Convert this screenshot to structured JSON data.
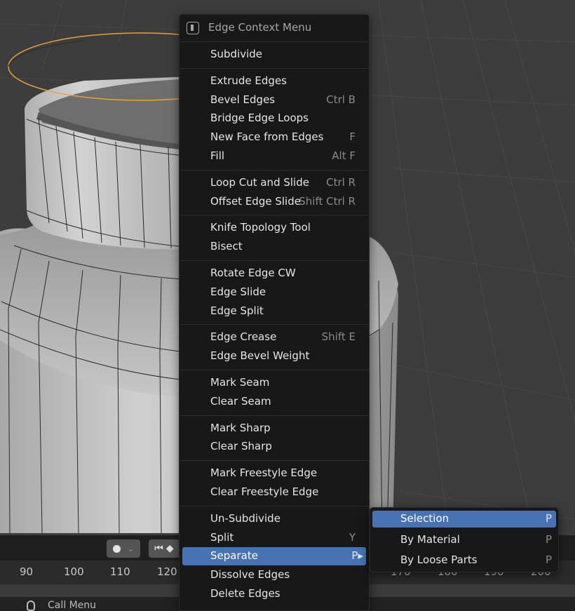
{
  "menu": {
    "title": "Edge Context Menu",
    "groups": [
      [
        {
          "label": "Subdivide",
          "shortcut": ""
        }
      ],
      [
        {
          "label": "Extrude Edges",
          "shortcut": ""
        },
        {
          "label": "Bevel Edges",
          "shortcut": "Ctrl B"
        },
        {
          "label": "Bridge Edge Loops",
          "shortcut": ""
        },
        {
          "label": "New Face from Edges",
          "shortcut": "F"
        },
        {
          "label": "Fill",
          "shortcut": "Alt F"
        }
      ],
      [
        {
          "label": "Loop Cut and Slide",
          "shortcut": "Ctrl R"
        },
        {
          "label": "Offset Edge Slide",
          "shortcut": "Shift Ctrl R"
        }
      ],
      [
        {
          "label": "Knife Topology Tool",
          "shortcut": ""
        },
        {
          "label": "Bisect",
          "shortcut": ""
        }
      ],
      [
        {
          "label": "Rotate Edge CW",
          "shortcut": ""
        },
        {
          "label": "Edge Slide",
          "shortcut": ""
        },
        {
          "label": "Edge Split",
          "shortcut": ""
        }
      ],
      [
        {
          "label": "Edge Crease",
          "shortcut": "Shift E"
        },
        {
          "label": "Edge Bevel Weight",
          "shortcut": ""
        }
      ],
      [
        {
          "label": "Mark Seam",
          "shortcut": ""
        },
        {
          "label": "Clear Seam",
          "shortcut": ""
        }
      ],
      [
        {
          "label": "Mark Sharp",
          "shortcut": ""
        },
        {
          "label": "Clear Sharp",
          "shortcut": ""
        }
      ],
      [
        {
          "label": "Mark Freestyle Edge",
          "shortcut": ""
        },
        {
          "label": "Clear Freestyle Edge",
          "shortcut": ""
        }
      ],
      [
        {
          "label": "Un-Subdivide",
          "shortcut": ""
        },
        {
          "label": "Split",
          "shortcut": "Y"
        },
        {
          "label": "Separate",
          "shortcut": "P▸",
          "active": true
        },
        {
          "label": "Dissolve Edges",
          "shortcut": ""
        },
        {
          "label": "Delete Edges",
          "shortcut": ""
        }
      ]
    ]
  },
  "submenu": {
    "items": [
      {
        "label": "Selection",
        "shortcut": "P",
        "active": true
      },
      {
        "label": "By Material",
        "shortcut": "P"
      },
      {
        "label": "By Loose Parts",
        "shortcut": "P"
      }
    ]
  },
  "timeline": {
    "frames": [
      "90",
      "100",
      "110",
      "120",
      "170",
      "180",
      "190",
      "200"
    ]
  },
  "statusbar": {
    "text": "Call Menu"
  },
  "colors": {
    "highlight": "#4772b3",
    "selected_edge": "#e8a23a",
    "menu_bg": "#181818",
    "viewport_bg": "#3d3d3d"
  }
}
